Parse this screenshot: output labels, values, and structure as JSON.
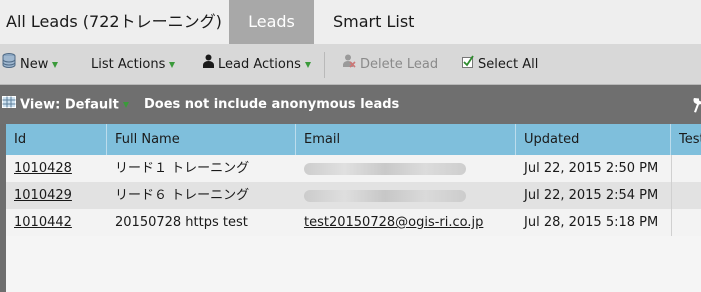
{
  "tabs": {
    "all_leads": "All Leads (722トレーニング)",
    "leads": "Leads",
    "smart_list": "Smart List"
  },
  "toolbar": {
    "new": "New",
    "list_actions": "List Actions",
    "lead_actions": "Lead Actions",
    "delete_lead": "Delete Lead",
    "select_all": "Select All"
  },
  "viewbar": {
    "view": "View: Default",
    "note": "Does not include anonymous leads"
  },
  "table": {
    "columns": [
      "Id",
      "Full Name",
      "Email",
      "Updated",
      "Test"
    ],
    "rows": [
      {
        "id": "1010428",
        "name": "リード１ トレーニング",
        "email": "",
        "email_obscured": true,
        "updated": "Jul 22, 2015 2:50 PM"
      },
      {
        "id": "1010429",
        "name": "リード６ トレーニング",
        "email": "",
        "email_obscured": true,
        "updated": "Jul 22, 2015 2:54 PM"
      },
      {
        "id": "1010442",
        "name": "20150728 https test",
        "email": "test20150728@ogis-ri.co.jp",
        "email_obscured": false,
        "updated": "Jul 28, 2015 5:18 PM"
      }
    ]
  },
  "colors": {
    "header_bg": "#7fbfdc",
    "active_tab": "#a8a8a8",
    "toolbar_bg": "#d8d8d8",
    "dropdown_arrow": "#3b9a3b"
  },
  "icons": {
    "new": "database-icon",
    "lead_actions": "person-icon",
    "delete_lead": "delete-person-icon",
    "select_all": "checkbox-icon",
    "view": "grid-icon",
    "tools": "wrench-icon"
  }
}
